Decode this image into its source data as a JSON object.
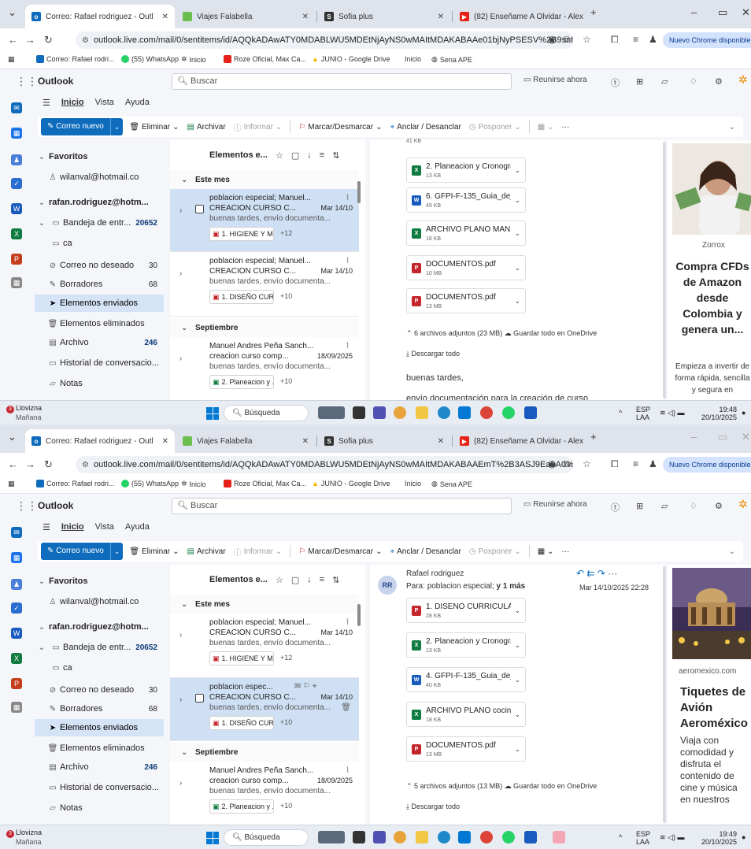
{
  "colors": {
    "accent": "#0f6cbd",
    "selected_row": "#cfe0f4",
    "selected_folder": "#d4e3f5"
  },
  "screens": [
    {
      "tabs": [
        {
          "label": "Correo: Rafael rodriguez - Outl",
          "close": "✕"
        },
        {
          "label": "Viajes Falabella",
          "close": "✕"
        },
        {
          "label": "Sofia plus",
          "close": "✕"
        },
        {
          "label": "(82) Enseñame A Olvidar - Alex",
          "close": "✕"
        }
      ],
      "new_tab": "+",
      "url": "outlook.live.com/mail/0/sentitems/id/AQQkADAwATY0MDABLWU5MDEtNjAyNS0wMAItMDAKABAAe01bjNyPSESV%2B9snfl...",
      "chrome_update": "Nuevo Chrome disponible",
      "bookmarks": [
        "Correo: Rafael rodri...",
        "(55) WhatsApp",
        "Inicio",
        "Roze Oficial, Max Ca...",
        "JUNIO - Google Drive",
        "Inicio",
        "Sena APE"
      ],
      "app_name": "Outlook",
      "search_placeholder": "Buscar",
      "meet_now": "Reunirse ahora",
      "ribbon_tabs": [
        "Inicio",
        "Vista",
        "Ayuda"
      ],
      "toolbar": {
        "new_mail": "Correo nuevo",
        "delete": "Eliminar",
        "archive": "Archivar",
        "report": "Informar",
        "flag": "Marcar/Desmarcar",
        "pin": "Anclar / Desanclar",
        "snooze": "Posponer"
      },
      "folders": {
        "favorites": "Favoritos",
        "fav_account": "wilanval@hotmail.co",
        "account": "rafan.rodriguez@hotm...",
        "inbox": "Bandeja de entr...",
        "inbox_count": "20652",
        "ca": "ca",
        "junk": "Correo no deseado",
        "junk_count": "30",
        "drafts": "Borradores",
        "drafts_count": "68",
        "sent": "Elementos enviados",
        "deleted": "Elementos eliminados",
        "archive": "Archivo",
        "archive_count": "246",
        "history": "Historial de conversacio...",
        "notes": "Notas"
      },
      "list_title": "Elementos e...",
      "groups": {
        "month": "Este mes",
        "september": "Septiembre"
      },
      "messages": [
        {
          "from": "poblacion especial; Manuel...",
          "subject": "CREACION CURSO C...",
          "date": "Mar 14/10",
          "preview": "buenas tardes, envío documenta...",
          "attachment": "1. HIGIENE Y M...",
          "more": "+12"
        },
        {
          "from": "poblacion especial; Manuel...",
          "subject": "CREACION CURSO C...",
          "date": "Mar 14/10",
          "preview": "buenas tardes, envío documenta...",
          "attachment": "1. DISEÑO CUR...",
          "more": "+10"
        },
        {
          "from": "Manuel Andres Peña Sanch...",
          "subject": "creacion curso comp...",
          "date": "18/09/2025",
          "preview": "buenas tardes, envío documenta...",
          "attachment": "2. Planeacion y ...",
          "more": "+10"
        }
      ],
      "reading": {
        "top_size": "41 KB",
        "files": [
          {
            "name": "2. Planeacion y Cronograma ...",
            "size": "13 KB",
            "type": "xls"
          },
          {
            "name": "6. GFPI-F-135_Guia_de_Apre...",
            "size": "49 KB",
            "type": "doc"
          },
          {
            "name": "ARCHIVO PLANO MANIPULA...",
            "size": "18 KB",
            "type": "xls"
          },
          {
            "name": "DOCUMENTOS.pdf",
            "size": "10 MB",
            "type": "pdf"
          },
          {
            "name": "DOCUMENTOS.pdf",
            "size": "13 MB",
            "type": "pdf"
          }
        ],
        "summary": "6 archivos adjuntos (23 MB)",
        "save_onedrive": "Guardar todo en OneDrive",
        "download_all": "Descargar todo",
        "greeting": "buenas tardes,",
        "body": "envío documentación para la creación de curso"
      },
      "ad": {
        "source": "Zorrox",
        "title": "Compra CFDs de Amazon desde Colombia y genera un...",
        "text": "Empieza a invertir de forma rápida, sencilla y segura en"
      },
      "taskbar": {
        "weather": "Llovizna",
        "weather_sub": "Mañana",
        "badge": "3",
        "search": "Búsqueda",
        "lang": "ESP",
        "lang_sub": "LAA",
        "time": "19:48",
        "date": "20/10/2025"
      }
    },
    {
      "tabs": [
        {
          "label": "Correo: Rafael rodriguez - Outl",
          "close": "✕"
        },
        {
          "label": "Viajes Falabella",
          "close": "✕"
        },
        {
          "label": "Sofia plus",
          "close": "✕"
        },
        {
          "label": "(82) Enseñame A Olvidar - Alex",
          "close": "✕"
        }
      ],
      "new_tab": "+",
      "url": "outlook.live.com/mail/0/sentitems/id/AQQkADAwATY0MDABLWU5MDEtNjAyNS0wMAItMDAKABAAEmT%2B3ASJ9Ea0A0%2...",
      "chrome_update": "Nuevo Chrome disponible",
      "bookmarks": [
        "Correo: Rafael rodri...",
        "(55) WhatsApp",
        "Inicio",
        "Roze Oficial, Max Ca...",
        "JUNIO - Google Drive",
        "Inicio",
        "Sena APE"
      ],
      "app_name": "Outlook",
      "search_placeholder": "Buscar",
      "meet_now": "Reunirse ahora",
      "ribbon_tabs": [
        "Inicio",
        "Vista",
        "Ayuda"
      ],
      "toolbar": {
        "new_mail": "Correo nuevo",
        "delete": "Eliminar",
        "archive": "Archivar",
        "report": "Informar",
        "flag": "Marcar/Desmarcar",
        "pin": "Anclar / Desanclar",
        "snooze": "Posponer"
      },
      "folders": {
        "favorites": "Favoritos",
        "fav_account": "wilanval@hotmail.co",
        "account": "rafan.rodriguez@hotm...",
        "inbox": "Bandeja de entr...",
        "inbox_count": "20652",
        "ca": "ca",
        "junk": "Correo no deseado",
        "junk_count": "30",
        "drafts": "Borradores",
        "drafts_count": "68",
        "sent": "Elementos enviados",
        "deleted": "Elementos eliminados",
        "archive": "Archivo",
        "archive_count": "246",
        "history": "Historial de conversacio...",
        "notes": "Notas"
      },
      "list_title": "Elementos e...",
      "groups": {
        "month": "Este mes",
        "september": "Septiembre"
      },
      "messages": [
        {
          "from": "poblacion especial; Manuel...",
          "subject": "CREACION CURSO C...",
          "date": "Mar 14/10",
          "preview": "buenas tardes, envío documenta...",
          "attachment": "1. HIGIENE Y M...",
          "more": "+12"
        },
        {
          "from": "poblacion espec...",
          "subject": "CREACION CURSO C...",
          "date": "Mar 14/10",
          "preview": "buenas tardes, envío documenta...",
          "attachment": "1. DISEÑO CUR...",
          "more": "+10"
        },
        {
          "from": "Manuel Andres Peña Sanch...",
          "subject": "creacion curso comp...",
          "date": "18/09/2025",
          "preview": "buenas tardes, envío documenta...",
          "attachment": "2. Planeacion y ...",
          "more": "+10"
        }
      ],
      "reading": {
        "avatar": "RR",
        "sender": "Rafael rodriguez",
        "to_label": "Para:",
        "to": "poblacion especial;",
        "to_more": "y 1 más",
        "date": "Mar 14/10/2025 22:28",
        "files": [
          {
            "name": "1. DISEÑO CURRICULAR COC...",
            "size": "28 KB",
            "type": "pdf"
          },
          {
            "name": "2. Planeacion y Cronograma ...",
            "size": "13 KB",
            "type": "xls"
          },
          {
            "name": "4. GFPI-F-135_Guia_de_Apre...",
            "size": "40 KB",
            "type": "doc"
          },
          {
            "name": "ARCHIVO PLANO cocina basi...",
            "size": "18 KB",
            "type": "xls"
          },
          {
            "name": "DOCUMENTOS.pdf",
            "size": "13 MB",
            "type": "pdf"
          }
        ],
        "summary": "5 archivos adjuntos (13 MB)",
        "save_onedrive": "Guardar todo en OneDrive",
        "download_all": "Descargar todo"
      },
      "ad": {
        "source": "aeromexico.com",
        "title": "Tiquetes de Avión Aeroméxico",
        "text": "Viaja con comodidad y disfruta el contenido de cine y música en nuestros"
      },
      "taskbar": {
        "weather": "Llovizna",
        "weather_sub": "Mañana",
        "badge": "3",
        "search": "Búsqueda",
        "lang": "ESP",
        "lang_sub": "LAA",
        "time": "19:49",
        "date": "20/10/2025"
      }
    }
  ]
}
